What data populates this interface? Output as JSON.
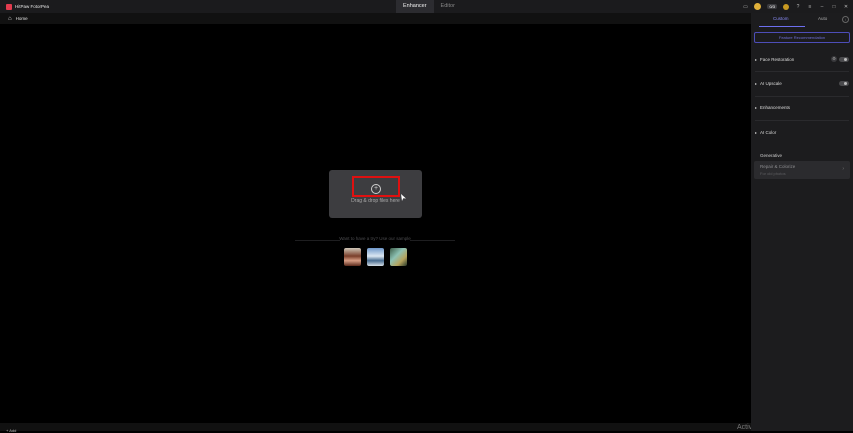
{
  "app": {
    "title": "HitPaw FotorPea"
  },
  "tabs": [
    "Enhancer",
    "Editor"
  ],
  "header": {
    "badge": "0/3"
  },
  "nav": {
    "home": "Home"
  },
  "upload": {
    "drop_text": "Drag & drop files here"
  },
  "samples": {
    "hint": "Want to have a try? Use our sample"
  },
  "panel": {
    "tabs": {
      "custom": "Custom",
      "auto": "Auto"
    },
    "recommendation": "Feature Recommendation",
    "sections": {
      "face_restoration": "Face Restoration",
      "ai_upscale": "AI Upscale",
      "enhancements": "Enhancements",
      "ai_color": "AI Color"
    },
    "generative": {
      "title": "Generative",
      "repair_title": "Repair & Colorize",
      "repair_sub": "For old photos"
    }
  },
  "bottom": {
    "add_label": "+ Add"
  },
  "watermark": "Activate Windows",
  "icons": {
    "logo": "app-logo-icon",
    "home": "home-icon",
    "plus": "plus-circle-icon",
    "minimize": "minimize-icon",
    "maximize": "maximize-icon",
    "close": "close-icon"
  },
  "colors": {
    "accent": "#6d6ff0",
    "highlight": "#e01010",
    "brand": "#e23b4e"
  }
}
